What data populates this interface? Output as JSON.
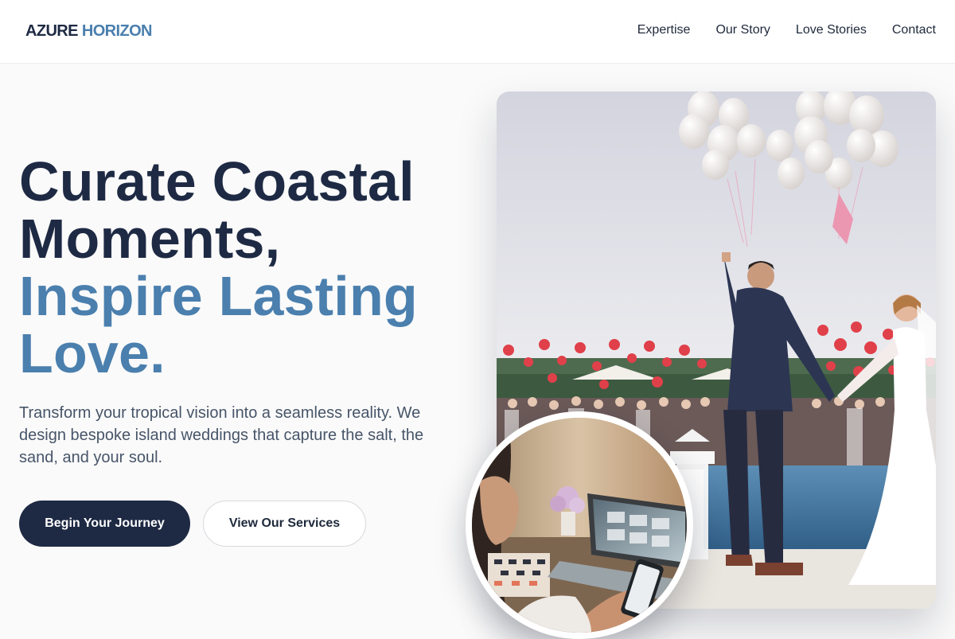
{
  "brand": {
    "name_part1": "AZURE",
    "name_part2": "HORIZON"
  },
  "nav": {
    "items": [
      {
        "label": "Expertise"
      },
      {
        "label": "Our Story"
      },
      {
        "label": "Love Stories"
      },
      {
        "label": "Contact"
      }
    ]
  },
  "hero": {
    "title_line1": "Curate Coastal",
    "title_line2": "Moments,",
    "title_line3": "Inspire Lasting",
    "title_line4": "Love.",
    "description": "Transform your tropical vision into a seamless reality. We design bespoke island weddings that capture the salt, the sand, and your soul.",
    "primary_button": "Begin Your Journey",
    "secondary_button": "View Our Services"
  },
  "colors": {
    "navy": "#1e2a44",
    "accent_blue": "#4a7fae",
    "body_text": "#475569",
    "page_background": "#fafafa"
  }
}
